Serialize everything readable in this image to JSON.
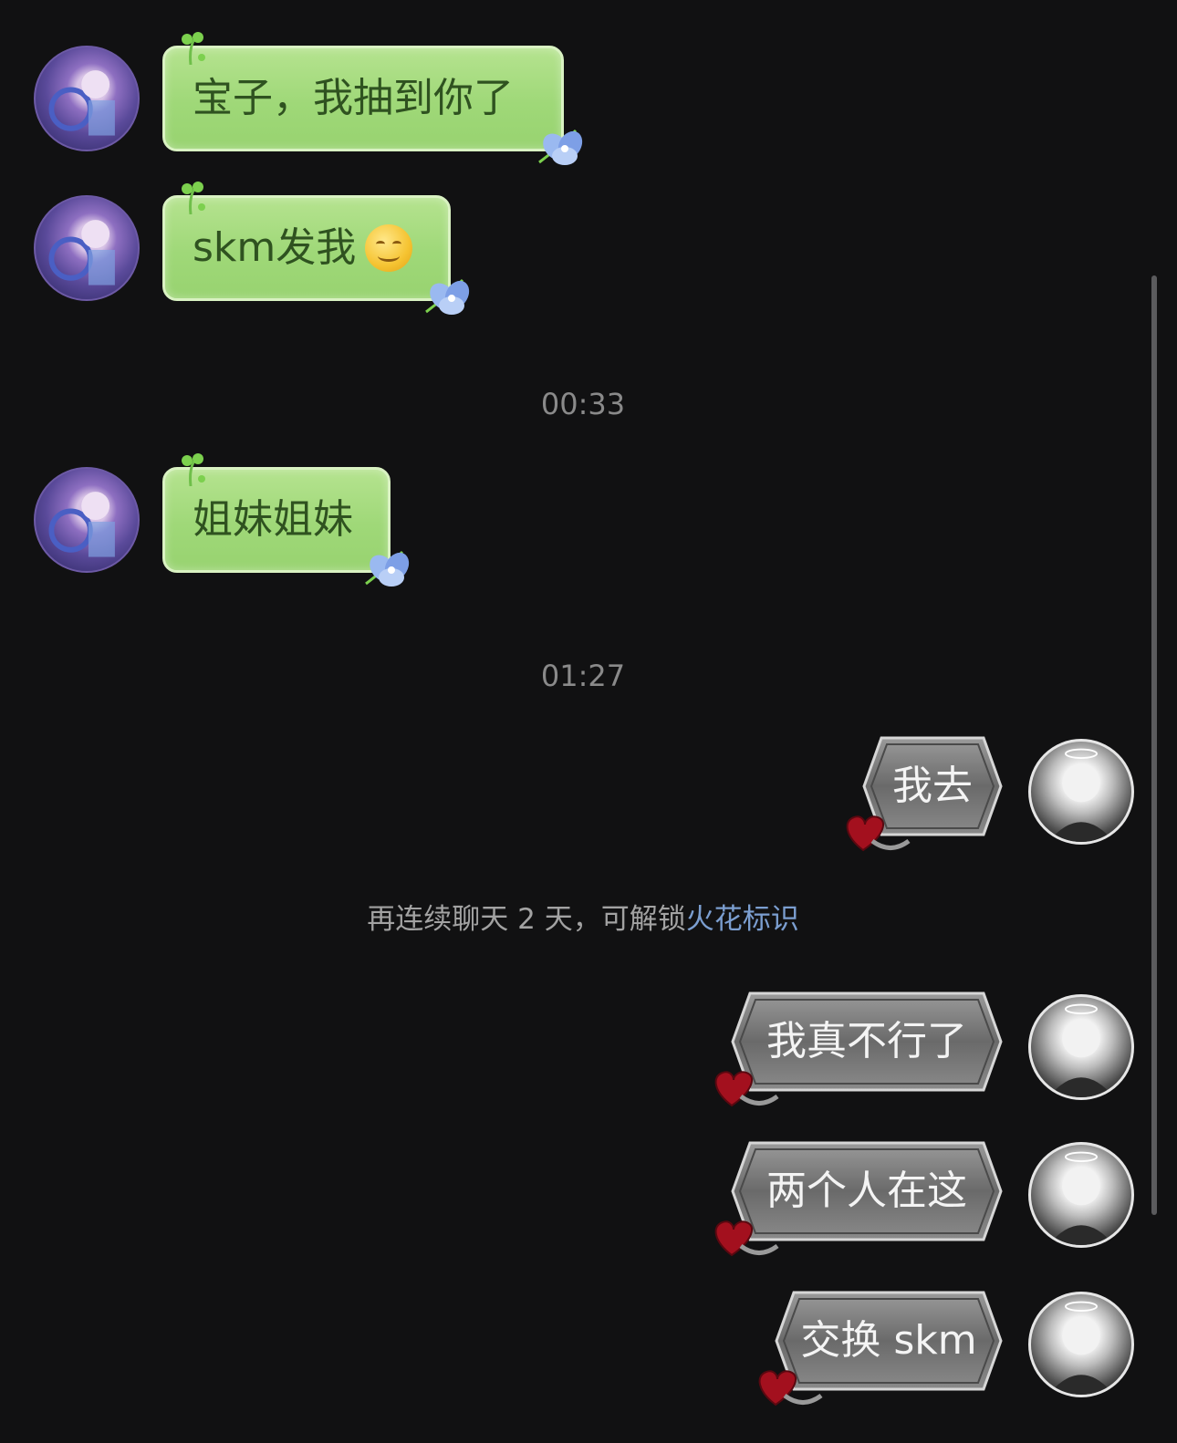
{
  "messages": [
    {
      "side": "left",
      "text": "宝子，我抽到你了"
    },
    {
      "side": "left",
      "text": "skm发我",
      "emoji": "grinning-emoji"
    },
    {
      "side": "left",
      "text": "姐妹姐妹"
    },
    {
      "side": "right",
      "text": "我去"
    },
    {
      "side": "right",
      "text": "我真不行了"
    },
    {
      "side": "right",
      "text": "两个人在这"
    },
    {
      "side": "right",
      "text": "交换 skm"
    }
  ],
  "timestamps": [
    "00:33",
    "01:27"
  ],
  "system": {
    "prefix": "再连续聊天 2 天，可解锁",
    "link": "火花标识"
  },
  "colors": {
    "background": "#111112",
    "green_bubble": "#9fd878",
    "link": "#7b9ed0"
  }
}
